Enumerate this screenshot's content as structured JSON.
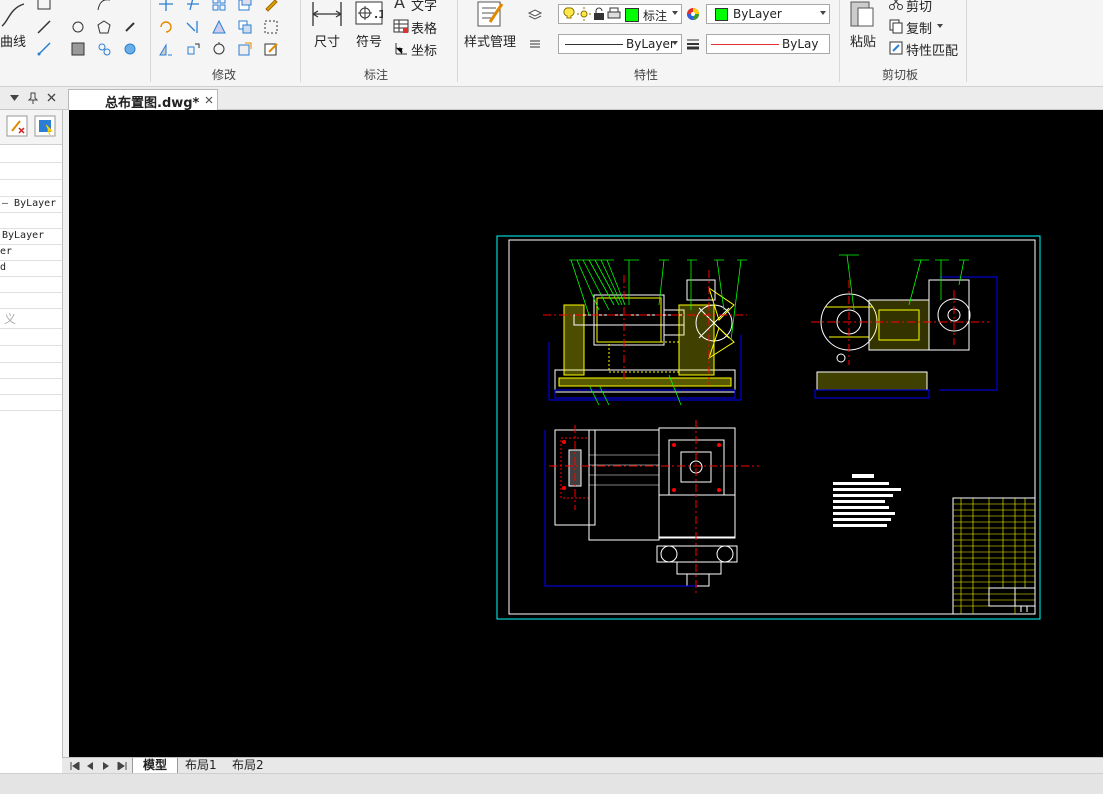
{
  "ribbon": {
    "draw": {
      "curve_label": "曲线"
    },
    "modify": {
      "group_label": "修改"
    },
    "annotation": {
      "group_label": "标注",
      "dimension_label": "尺寸",
      "symbol_label": "符号",
      "text_label": "文字",
      "table_label": "表格",
      "coordinate_label": "坐标"
    },
    "properties": {
      "group_label": "特性",
      "style_manager_label": "样式管理",
      "layer_value": "标注",
      "color_value": "ByLayer",
      "linetype_value": "ByLayer",
      "lineweight_value": "ByLay"
    },
    "clipboard": {
      "group_label": "剪切板",
      "paste_label": "粘贴",
      "cut_label": "剪切",
      "copy_label": "复制",
      "match_label": "特性匹配"
    }
  },
  "document_tab": {
    "title": "总布置图.dwg*"
  },
  "left_panel": {
    "rows": [
      "ByLayer",
      "ByLayer",
      "er",
      "d",
      "义"
    ]
  },
  "layout_tabs": [
    "模型",
    "布局1",
    "布局2"
  ],
  "colors": {
    "layer_swatch": "#00ff00",
    "canvas": "#000000",
    "frame": "#00ffff",
    "dimension": "#00ff00",
    "centerline": "#ff0000",
    "hatch": "#ffff00",
    "outline": "#ffffff",
    "blue_lines": "#0000ff"
  }
}
